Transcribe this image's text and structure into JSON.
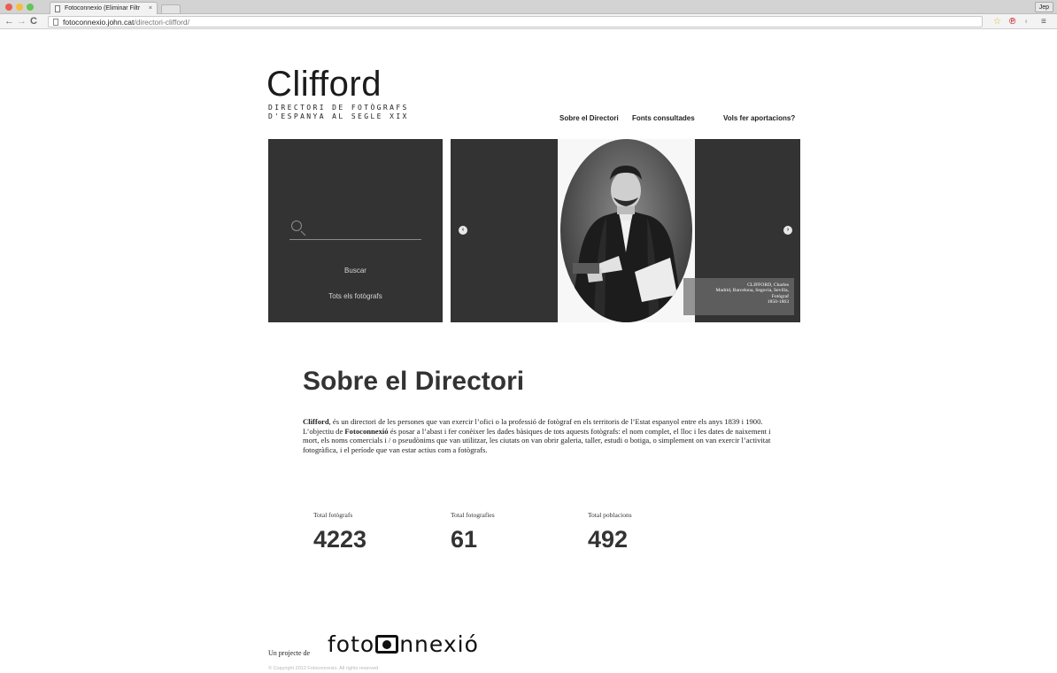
{
  "browser": {
    "tab_title": "Fotoconnexio (Eliminar Filtr",
    "tab_close": "×",
    "profile": "Jep",
    "url_host": "fotoconnexio.john.cat",
    "url_path": "/directori-clifford/",
    "nav": {
      "back": "←",
      "forward": "→",
      "reload": "C"
    },
    "extensions": {
      "star": "☆",
      "pinterest": "℗",
      "other": "◐",
      "menu": "≡"
    }
  },
  "header": {
    "logo_title": "Clifford",
    "logo_subtitle_1": "DIRECTORI DE FOTÒGRAFS",
    "logo_subtitle_2": "D'ESPANYA AL SEGLE XIX",
    "nav": [
      "Sobre el Directori",
      "Fonts consultades",
      "Vols fer aportacions?"
    ]
  },
  "search": {
    "placeholder": "",
    "buscar": "Buscar",
    "tots": "Tots els fotògrafs"
  },
  "carousel": {
    "prev": "‹",
    "next": "›",
    "caption_lines": [
      "CLIFFORD, Charles",
      "Madrid, Barcelona, Segovia, Sevilla,",
      "Fotògraf",
      "1850-1863"
    ]
  },
  "about": {
    "title": "Sobre el Directori",
    "intro_strong_1": "Clifford",
    "intro_text_1": ", és un directori de les persones que van exercir l’ofici o la professió de fotògraf en els territoris de l’Estat espanyol entre els anys 1839 i 1900. L’objectiu de ",
    "intro_strong_2": "Fotoconnexió",
    "intro_text_2": " és posar a l’abast i fer conèixer les dades bàsiques de tots aquests fotògrafs: el nom complet, el lloc i les dates de naixement i mort, els noms comercials i / o pseudònims que van utilitzar, les ciutats on van obrir galeria, taller, estudi o botiga, o simplement on van exercir l’activitat fotogràfica, i el període que van estar actius com a fotògrafs."
  },
  "stats": [
    {
      "label": "Total fotògrafs",
      "value": "4223"
    },
    {
      "label": "Total fotografies",
      "value": "61"
    },
    {
      "label": "Total poblacions",
      "value": "492"
    }
  ],
  "footer": {
    "prefix": "Un projecte de",
    "logo_part1": "foto",
    "logo_part2": "nnexió",
    "copyright": "© Copyright 2012 Fotoconnexio. All rights reserved"
  }
}
